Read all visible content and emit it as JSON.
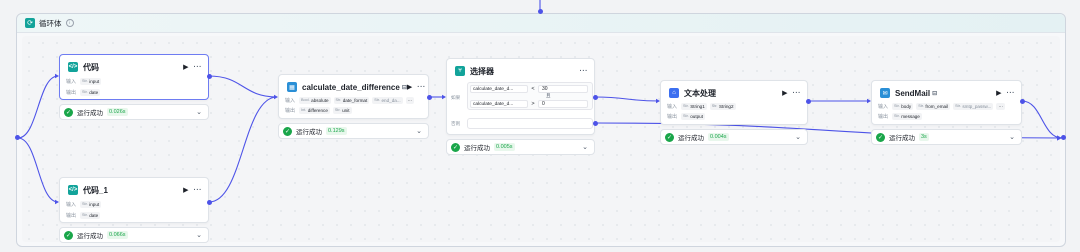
{
  "colors": {
    "edge": "#4d53e8",
    "success": "#1aa64a",
    "selected_border": "#6e7cf2"
  },
  "loop": {
    "title": "循环体",
    "icon": "loop-icon",
    "info_icon": "info-icon"
  },
  "labels": {
    "input": "输入",
    "output": "输出",
    "status_success": "运行成功",
    "if_label": "如果",
    "and_label": "且",
    "else_label": "否则",
    "run_glyph": "▶",
    "more_glyph": "···",
    "chevron_glyph": "⌄",
    "check_glyph": "✓"
  },
  "nodes": {
    "code": {
      "title": "代码",
      "icon": "code-icon",
      "inputs": [
        {
          "type": "Str.",
          "name": "input"
        }
      ],
      "outputs": [
        {
          "type": "Str.",
          "name": "date"
        }
      ],
      "duration": "0.026s"
    },
    "code1": {
      "title": "代码_1",
      "icon": "code-icon",
      "inputs": [
        {
          "type": "Str.",
          "name": "input"
        }
      ],
      "outputs": [
        {
          "type": "Str.",
          "name": "date"
        }
      ],
      "duration": "0.066s"
    },
    "calc": {
      "title": "calculate_date_difference",
      "title_suffix": "⊟",
      "icon": "plugin-icon",
      "inputs": [
        {
          "type": "Bool.",
          "name": "absolute"
        },
        {
          "type": "Str.",
          "name": "date_format"
        },
        {
          "type": "Str.",
          "name": "end_da..."
        }
      ],
      "inputs_more": "···",
      "outputs": [
        {
          "type": "Int.",
          "name": "difference"
        },
        {
          "type": "Str.",
          "name": "unit"
        }
      ],
      "duration": "0.129s"
    },
    "selector": {
      "title": "选择器",
      "icon": "selector-icon",
      "conditions": [
        {
          "left": "calculate_date_d...",
          "op": "<",
          "right": "30"
        },
        {
          "left": "calculate_date_d...",
          "op": ">",
          "right": "0"
        }
      ],
      "duration": "0.005s"
    },
    "text": {
      "title": "文本处理",
      "icon": "text-processing-icon",
      "inputs": [
        {
          "type": "Str.",
          "name": "String1"
        },
        {
          "type": "Str.",
          "name": "String2"
        }
      ],
      "outputs": [
        {
          "type": "Str.",
          "name": "output"
        }
      ],
      "duration": "0.004s"
    },
    "mail": {
      "title": "SendMail",
      "title_suffix": "⊟",
      "icon": "mail-icon",
      "inputs": [
        {
          "type": "Str.",
          "name": "body"
        },
        {
          "type": "Str.",
          "name": "from_email"
        },
        {
          "type": "Str.",
          "name": "smtp_passw..."
        }
      ],
      "inputs_more": "···",
      "outputs": [
        {
          "type": "Str.",
          "name": "message"
        }
      ],
      "duration": "3s"
    }
  }
}
